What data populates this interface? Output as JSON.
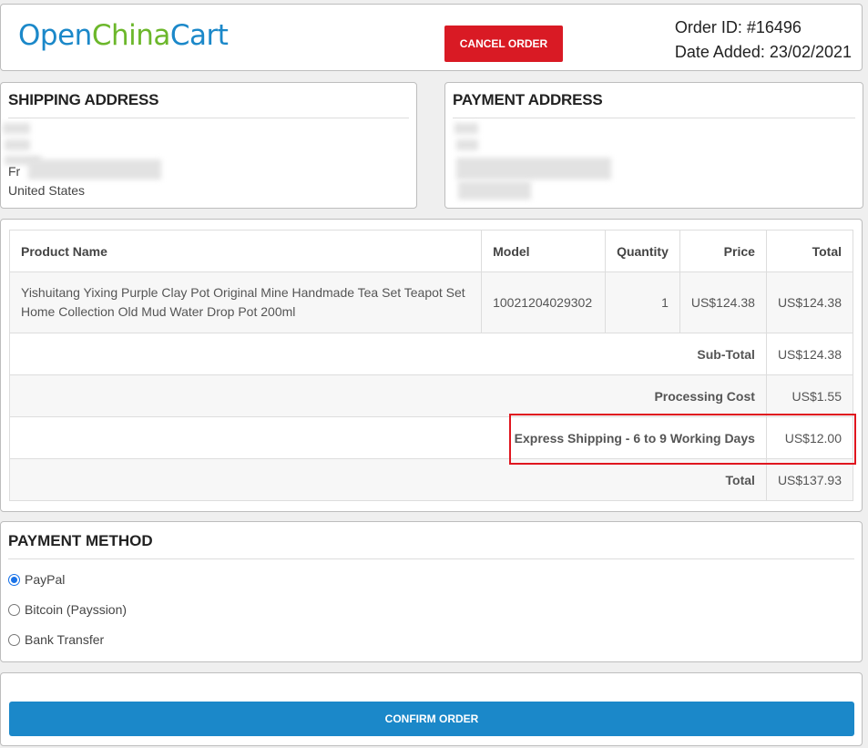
{
  "header": {
    "logo": {
      "part1": "Open",
      "part2": "China",
      "part3": "Cart"
    },
    "cancel_label": "CANCEL ORDER",
    "order_id": "Order ID: #16496",
    "date_added": "Date Added: 23/02/2021"
  },
  "shipping": {
    "title": "SHIPPING ADDRESS",
    "partial_line": "Fr",
    "country": "United States"
  },
  "payment_address": {
    "title": "PAYMENT ADDRESS"
  },
  "order_table": {
    "columns": [
      "Product Name",
      "Model",
      "Quantity",
      "Price",
      "Total"
    ],
    "rows": [
      {
        "name": "Yishuitang Yixing Purple Clay Pot Original Mine Handmade Tea Set Teapot Set Home Collection Old Mud Water Drop Pot 200ml",
        "model": "10021204029302",
        "quantity": "1",
        "price": "US$124.38",
        "total": "US$124.38"
      }
    ],
    "totals": [
      {
        "label": "Sub-Total",
        "value": "US$124.38"
      },
      {
        "label": "Processing Cost",
        "value": "US$1.55"
      },
      {
        "label": "Express Shipping - 6 to 9 Working Days",
        "value": "US$12.00"
      },
      {
        "label": "Total",
        "value": "US$137.93"
      }
    ],
    "highlight_color": "#e0161f"
  },
  "payment_method": {
    "title": "PAYMENT METHOD",
    "options": [
      {
        "label": "PayPal",
        "selected": true
      },
      {
        "label": "Bitcoin (Payssion)",
        "selected": false
      },
      {
        "label": "Bank Transfer",
        "selected": false
      }
    ]
  },
  "confirm_label": "CONFIRM ORDER",
  "colors": {
    "brand_blue": "#1b88c9",
    "brand_green": "#6cb72b",
    "cancel_red": "#d91a24"
  }
}
